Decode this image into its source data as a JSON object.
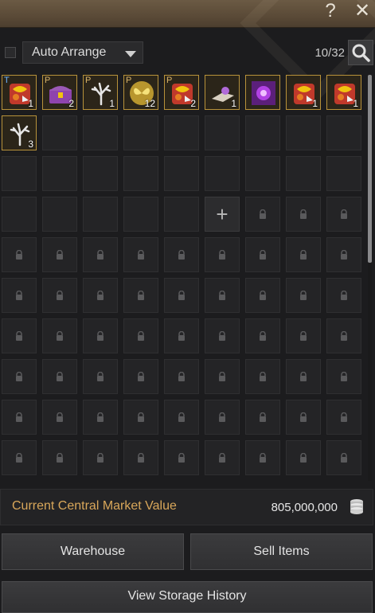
{
  "titlebar": {
    "help_label": "?",
    "close_label": "✕"
  },
  "toolbar": {
    "auto_arrange_label": "Auto Arrange",
    "slot_count": "10/32"
  },
  "items": [
    {
      "grade": "T",
      "qty": "1",
      "icon": "red-fish-icon"
    },
    {
      "grade": "P",
      "qty": "2",
      "icon": "purple-chest-icon"
    },
    {
      "grade": "P",
      "qty": "1",
      "icon": "white-coral-icon"
    },
    {
      "grade": "P",
      "qty": "12",
      "icon": "golden-butterfly-icon"
    },
    {
      "grade": "P",
      "qty": "2",
      "icon": "red-fish-icon"
    },
    {
      "grade": "",
      "qty": "1",
      "icon": "open-book-icon"
    },
    {
      "grade": "",
      "qty": "",
      "icon": "purple-scroll-icon"
    },
    {
      "grade": "",
      "qty": "1",
      "icon": "red-fish-icon"
    },
    {
      "grade": "",
      "qty": "1",
      "icon": "red-fish-icon"
    },
    {
      "grade": "",
      "qty": "3",
      "icon": "white-coral-icon"
    }
  ],
  "add_slot_label": "+",
  "market": {
    "label": "Current Central Market Value",
    "value": "805,000,000",
    "icon": "silver-coins-icon"
  },
  "buttons": {
    "warehouse": "Warehouse",
    "sell_items": "Sell Items",
    "view_history": "View Storage History"
  },
  "colors": {
    "accent_gold": "#b8923a",
    "market_label": "#d9a75a"
  }
}
